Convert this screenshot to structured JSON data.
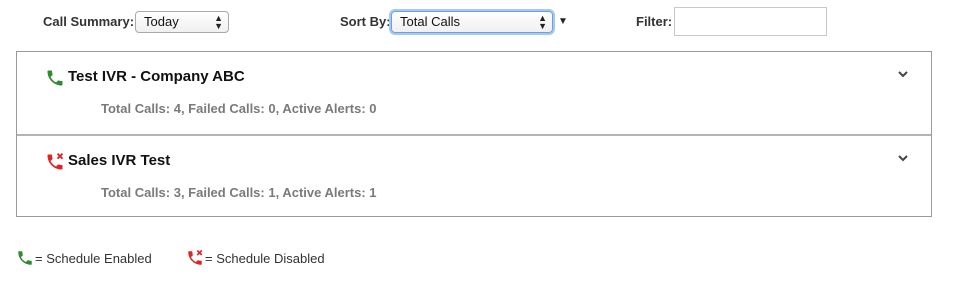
{
  "toolbar": {
    "call_summary_label": "Call Summary:",
    "call_summary_value": "Today",
    "sort_by_label": "Sort By:",
    "sort_by_value": "Total Calls",
    "filter_label": "Filter:",
    "filter_value": "",
    "filter_placeholder": ""
  },
  "panels": [
    {
      "title": "Test IVR - Company ABC",
      "stats": "Total Calls: 4, Failed Calls: 0, Active Alerts: 0",
      "icon": "phone-enabled-icon"
    },
    {
      "title": "Sales IVR Test",
      "stats": "Total Calls: 3, Failed Calls: 1, Active Alerts: 1",
      "icon": "phone-disabled-icon"
    }
  ],
  "legend": {
    "enabled_label": "= Schedule Enabled",
    "disabled_label": "= Schedule Disabled"
  },
  "colors": {
    "enabled": "#2e8b2e",
    "disabled": "#e02424",
    "focus_ring": "#a8c8f4"
  }
}
